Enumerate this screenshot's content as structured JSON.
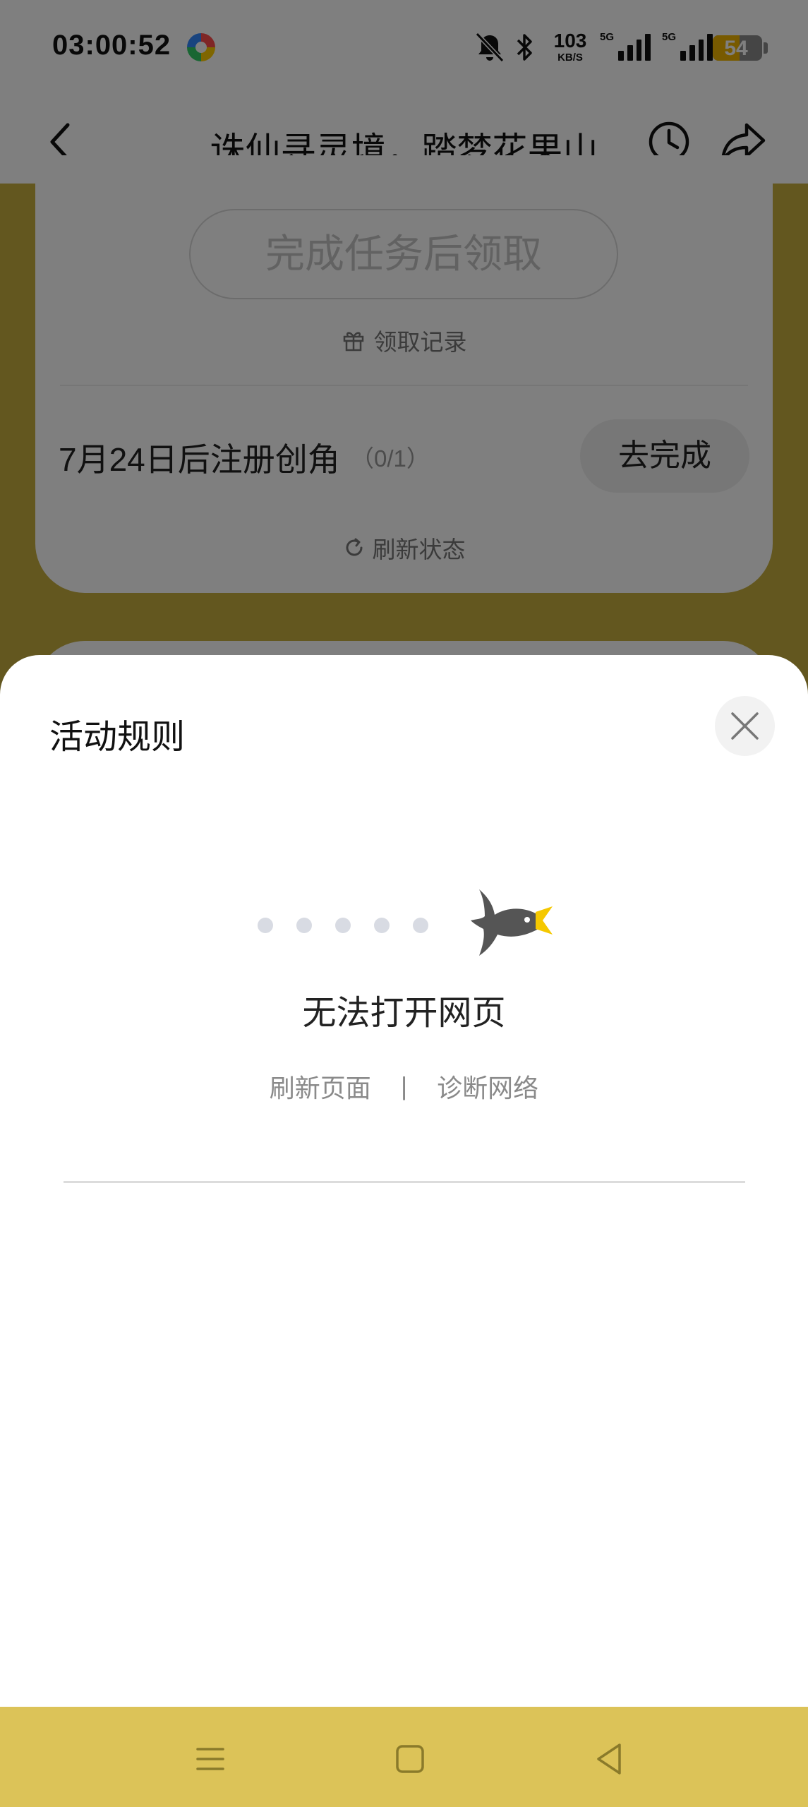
{
  "status_bar": {
    "time": "03:00:52",
    "network_speed": "103",
    "network_speed_unit": "KB/S",
    "signal1_label": "5G",
    "signal2_label": "5G",
    "battery": "54",
    "battery_level": 0.54
  },
  "nav": {
    "title": "诛仙寻灵境，踏梦花果山"
  },
  "task_card": {
    "claim_button": "完成任务后领取",
    "record_link": "领取记录",
    "task_label": "7月24日后注册创角",
    "task_count": "（0/1）",
    "go_button": "去完成",
    "refresh_link": "刷新状态"
  },
  "sheet": {
    "title": "活动规则",
    "error_title": "无法打开网页",
    "refresh_page": "刷新页面",
    "separator": "|",
    "diagnose_network": "诊断网络"
  },
  "icons": {
    "back": "chevron-left-icon",
    "history": "clock-icon",
    "share": "share-arrow-icon",
    "close": "close-icon",
    "gift": "gift-icon",
    "refresh": "refresh-icon",
    "bird": "bird-icon"
  },
  "colors": {
    "page_background": "#c6ae3f",
    "system_nav": "#dcc358",
    "bird": "#555555",
    "bird_beak": "#f5c800"
  }
}
